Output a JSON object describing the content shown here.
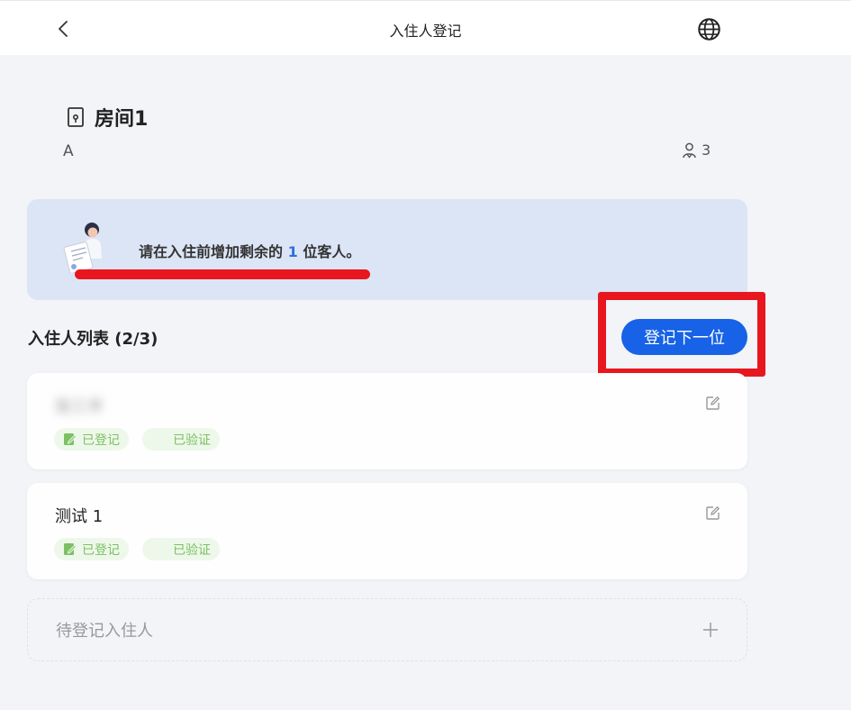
{
  "header": {
    "title": "入住人登记",
    "back_icon": "chevron-left-icon",
    "language_icon": "globe-icon"
  },
  "room": {
    "name": "房间1",
    "type": "A",
    "guest_count": "3"
  },
  "notice": {
    "prefix": "请在入住前增加剩余的",
    "remaining": "1",
    "suffix": "位客人。",
    "accent_color": "#2f6fe0"
  },
  "guest_list": {
    "title": "入住人列表 (2/3)",
    "next_button_label": "登记下一位",
    "guests": [
      {
        "name": "张三丰",
        "name_blurred": true,
        "registered_label": "已登记",
        "verified_label": "已验证"
      },
      {
        "name": "测试 1",
        "name_blurred": false,
        "registered_label": "已登记",
        "verified_label": "已验证"
      }
    ],
    "pending_label": "待登记入住人"
  },
  "colors": {
    "primary": "#1762e6",
    "annotation_red": "#e8161f",
    "tag_green": "#7cc063",
    "notice_bg": "#dce5f5"
  }
}
